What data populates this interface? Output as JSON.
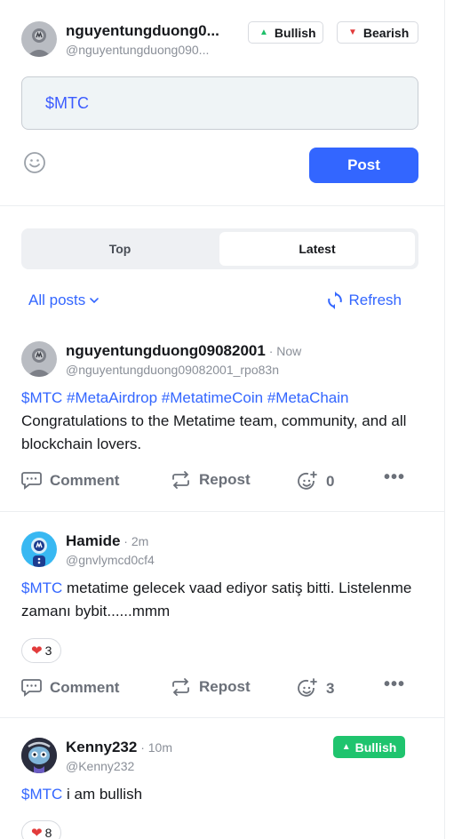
{
  "composer": {
    "user_name": "nguyentungduong0...",
    "user_handle": "@nguyentungduong090...",
    "bullish_label": "Bullish",
    "bearish_label": "Bearish",
    "input_value": "$MTC",
    "post_label": "Post"
  },
  "tabs": {
    "top": "Top",
    "latest": "Latest",
    "active": "Latest"
  },
  "filter": {
    "label": "All posts",
    "refresh": "Refresh"
  },
  "posts": [
    {
      "name": "nguyentungduong09082001",
      "time": " · Now",
      "handle": "@nguyentungduong09082001_rpo83n",
      "tags": "$MTC #MetaAirdrop #MetatimeCoin #MetaChain",
      "text": "Congratulations to the Metatime team, community, and all blockchain lovers.",
      "comment": "Comment",
      "repost": "Repost",
      "like_count": "0",
      "more": "•••"
    },
    {
      "name": "Hamide",
      "time": " · 2m",
      "handle": "@gnvlymcd0cf4",
      "tag": "$MTC",
      "text": " metatime gelecek vaad ediyor satiş bitti. Listelenme zamanı bybit......mmm",
      "reaction_count": "3",
      "comment": "Comment",
      "repost": "Repost",
      "like_count": "3",
      "more": "•••"
    },
    {
      "name": "Kenny232",
      "time": " · 10m",
      "handle": "@Kenny232",
      "badge": "Bullish",
      "tag": "$MTC",
      "text": " i am bullish",
      "reaction_count": "8"
    }
  ],
  "colors": {
    "accent": "#3366ff",
    "bullish": "#1fc46e",
    "bearish": "#e23b3b"
  }
}
